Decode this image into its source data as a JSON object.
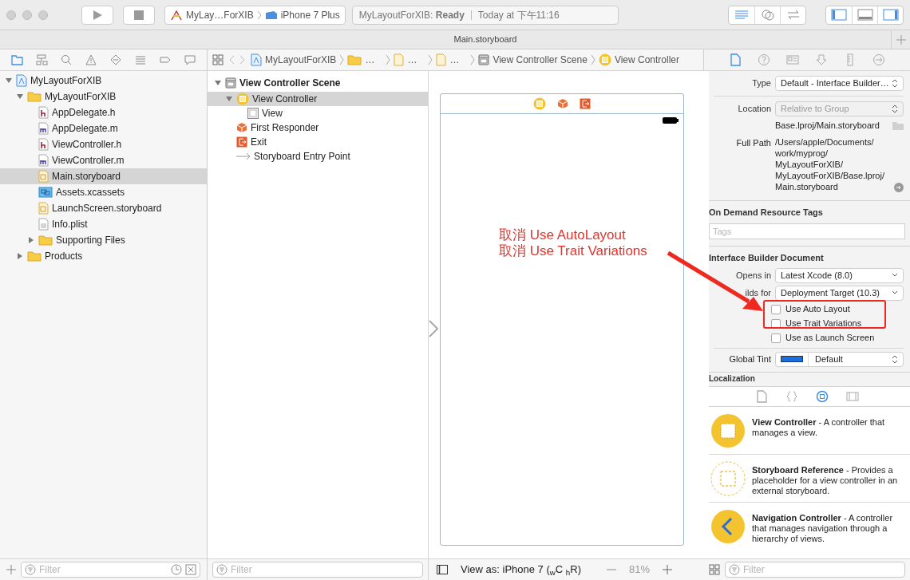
{
  "toolbar": {
    "scheme": "MyLay…ForXIB",
    "destination": "iPhone 7 Plus",
    "status_project": "MyLayoutForXIB: **Ready**",
    "status_time": "Today at 下午11:16",
    "editor_modes": [
      {
        "kind": "standard",
        "selected": true
      },
      {
        "kind": "assistant",
        "selected": false
      },
      {
        "kind": "version",
        "selected": false
      }
    ],
    "panels": [
      {
        "kind": "navigator",
        "on": true
      },
      {
        "kind": "debug",
        "on": false
      },
      {
        "kind": "utilities",
        "on": true
      }
    ]
  },
  "tab_bar": {
    "title": "Main.storyboard"
  },
  "navigator": {
    "tabs": [
      {
        "kind": "project",
        "selected": true
      },
      {
        "kind": "symbol",
        "selected": false
      },
      {
        "kind": "find",
        "selected": false
      },
      {
        "kind": "issue",
        "selected": false
      },
      {
        "kind": "test",
        "selected": false
      },
      {
        "kind": "debug",
        "selected": false
      },
      {
        "kind": "breakpoint",
        "selected": false
      },
      {
        "kind": "report",
        "selected": false
      }
    ],
    "tree": [
      {
        "kind": "project",
        "label": "MyLayoutForXIB",
        "expanded": true,
        "selected": false,
        "children": [
          {
            "kind": "folder",
            "label": "MyLayoutForXIB",
            "expanded": true,
            "selected": false,
            "children": [
              {
                "kind": "header",
                "label": "AppDelegate.h",
                "selected": false
              },
              {
                "kind": "impl",
                "label": "AppDelegate.m",
                "selected": false
              },
              {
                "kind": "header",
                "label": "ViewController.h",
                "selected": false
              },
              {
                "kind": "impl",
                "label": "ViewController.m",
                "selected": false
              },
              {
                "kind": "storyboard",
                "label": "Main.storyboard",
                "selected": true
              },
              {
                "kind": "assets",
                "label": "Assets.xcassets",
                "selected": false
              },
              {
                "kind": "storyboard",
                "label": "LaunchScreen.storyboard",
                "selected": false
              },
              {
                "kind": "plist",
                "label": "Info.plist",
                "selected": false
              },
              {
                "kind": "folder",
                "label": "Supporting Files",
                "expanded": false,
                "selected": false
              }
            ]
          },
          {
            "kind": "folder",
            "label": "Products",
            "expanded": false,
            "selected": false
          }
        ]
      }
    ],
    "filter": {
      "placeholder": "Filter"
    }
  },
  "jump_bar": {
    "items": [
      {
        "kind": "project",
        "label": "MyLayoutForXIB"
      },
      {
        "kind": "folder",
        "label": "…"
      },
      {
        "kind": "storyboard",
        "label": "…"
      },
      {
        "kind": "storyboard",
        "label": "…"
      },
      {
        "kind": "scene",
        "label": "View Controller Scene"
      },
      {
        "kind": "controller",
        "label": "View Controller"
      }
    ]
  },
  "outline": {
    "tree": [
      {
        "kind": "scene",
        "label": "View Controller Scene",
        "expanded": true,
        "selected": false,
        "children": [
          {
            "kind": "controller",
            "label": "View Controller",
            "expanded": true,
            "selected": true,
            "children": [
              {
                "kind": "view",
                "label": "View",
                "selected": false
              }
            ]
          },
          {
            "kind": "responder",
            "label": "First Responder",
            "selected": false
          },
          {
            "kind": "exit",
            "label": "Exit",
            "selected": false
          },
          {
            "kind": "entry",
            "label": "Storyboard Entry Point",
            "selected": false
          }
        ]
      }
    ],
    "filter": {
      "placeholder": "Filter"
    }
  },
  "canvas": {
    "annotation_lines": [
      "取消 Use AutoLayout",
      "取消 Use Trait Variations"
    ],
    "view_as": "View as: iPhone 7 ($_{w}$C $_{h}$R)",
    "zoom": "81%"
  },
  "inspector": {
    "tabs": [
      {
        "kind": "file",
        "selected": true
      },
      {
        "kind": "help",
        "selected": false
      },
      {
        "kind": "identity",
        "selected": false
      },
      {
        "kind": "attributes",
        "selected": false
      },
      {
        "kind": "size",
        "selected": false
      },
      {
        "kind": "connections",
        "selected": false
      }
    ],
    "type": {
      "label": "Type",
      "value": "Default - Interface Builder…"
    },
    "location": {
      "label": "Location",
      "value": "Relative to Group",
      "disabled": true
    },
    "path": "Base.lproj/Main.storyboard",
    "full_path": {
      "label": "Full Path",
      "lines": [
        "/Users/apple/Documents/",
        "work/myprog/",
        "MyLayoutForXIB/",
        "MyLayoutForXIB/Base.lproj/",
        "Main.storyboard"
      ]
    },
    "resource_tags": {
      "title": "On Demand Resource Tags",
      "placeholder": "Tags"
    },
    "ib_document": {
      "title": "Interface Builder Document",
      "opens_in": {
        "label": "Opens in",
        "value": "Latest Xcode (8.0)"
      },
      "builds_for": {
        "label": "ilds for",
        "value": "Deployment Target (10.3)"
      },
      "options": [
        {
          "label": "Use Auto Layout",
          "checked": false
        },
        {
          "label": "Use Trait Variations",
          "checked": false
        },
        {
          "label": "Use as Launch Screen",
          "checked": false
        }
      ],
      "global_tint": {
        "label": "Global Tint",
        "color": "#1a6fe0",
        "value": "Default"
      }
    },
    "localization": {
      "title": "Localization"
    }
  },
  "library": {
    "tabs": [
      {
        "kind": "file",
        "selected": false
      },
      {
        "kind": "snippet",
        "selected": false
      },
      {
        "kind": "object",
        "selected": true
      },
      {
        "kind": "media",
        "selected": false
      }
    ],
    "items": [
      {
        "kind": "view_controller",
        "text": "**View Controller** - A controller that manages a view."
      },
      {
        "kind": "storyboard_reference",
        "text": "**Storyboard Reference** - Provides a placeholder for a view controller in an external storyboard."
      },
      {
        "kind": "navigation_controller",
        "text": "**Navigation Controller** - A controller that manages navigation through a hierarchy of views."
      }
    ],
    "filter": {
      "placeholder": "Filter"
    }
  }
}
